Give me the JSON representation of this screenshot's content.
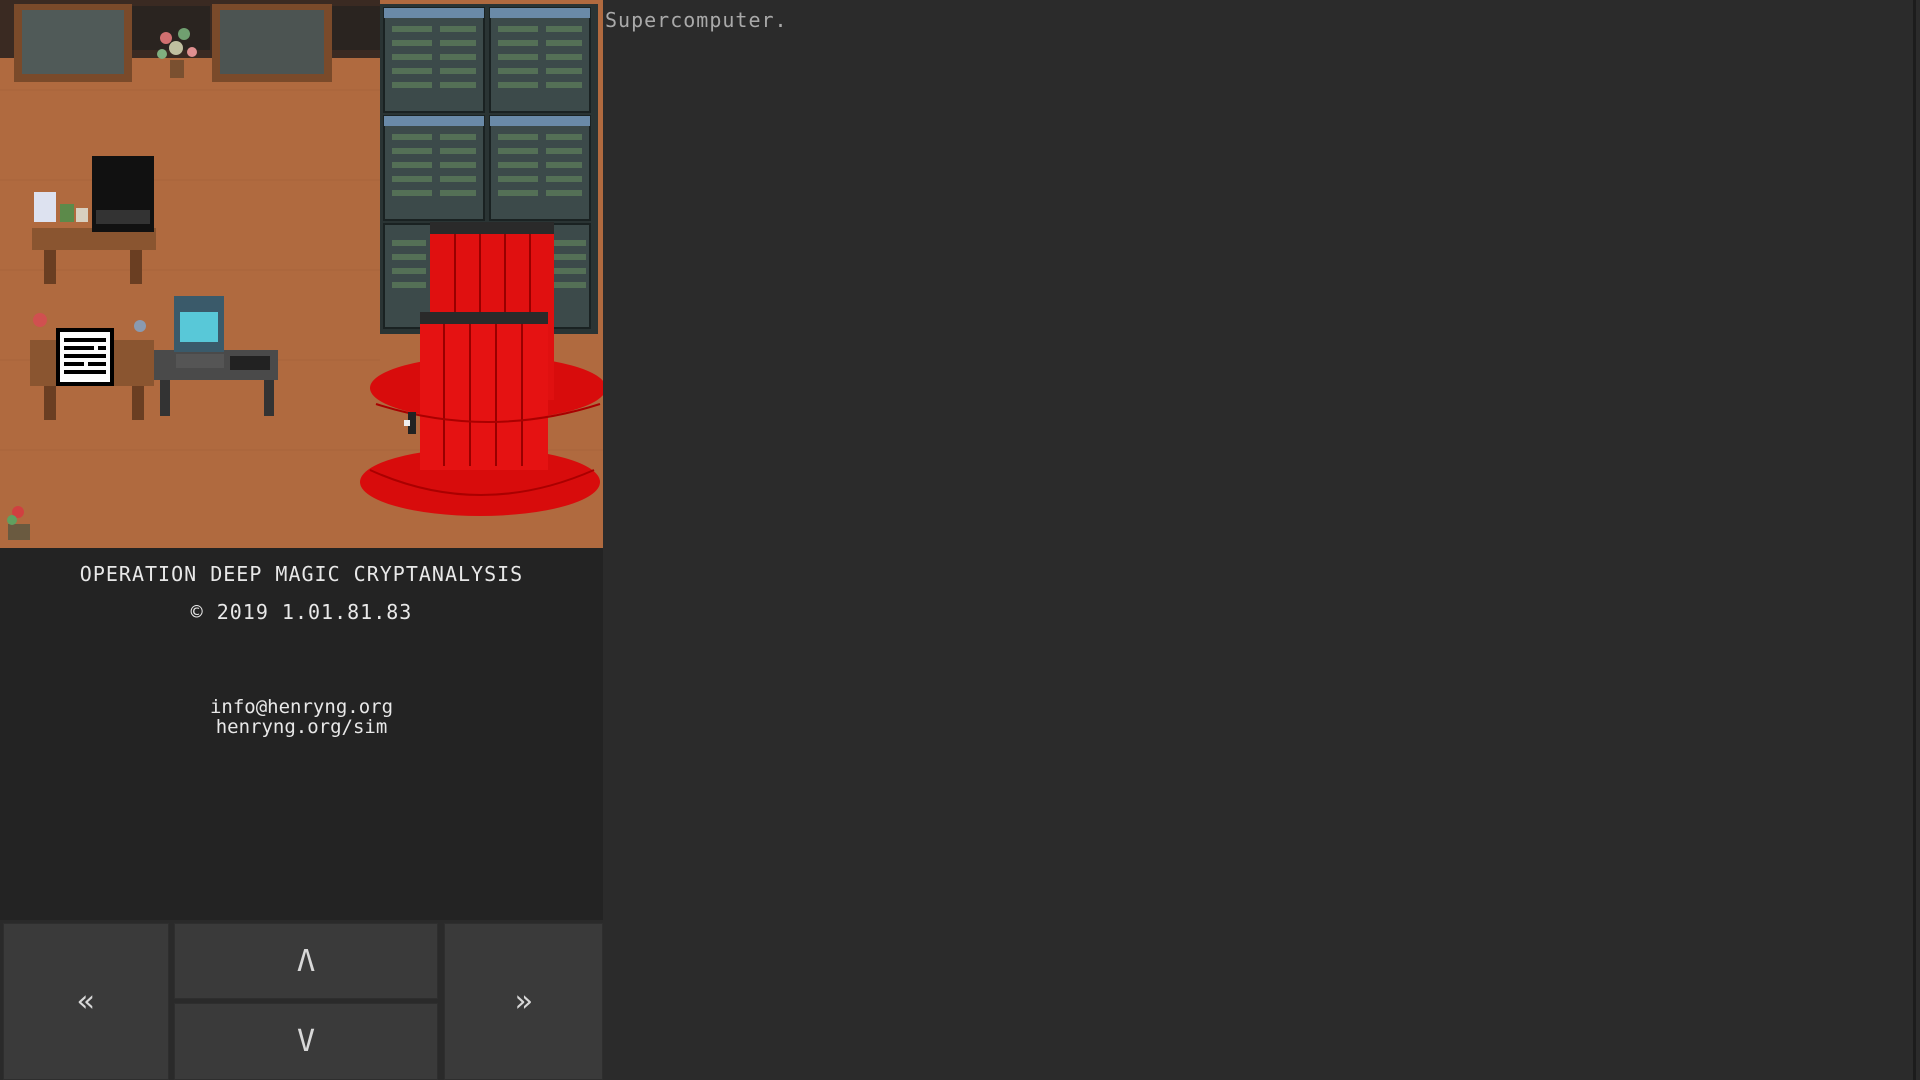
{
  "app": {
    "title": "OPERATION DEEP MAGIC CRYPTANALYSIS",
    "copyright": "© 2019 1.01.81.83",
    "email": "info@henryng.org",
    "site": "henryng.org/sim"
  },
  "controls": {
    "prev_label": "«",
    "up_label": "Λ",
    "down_label": "V",
    "next_label": "»"
  },
  "output": {
    "text": "Supercomputer."
  },
  "colors": {
    "floor": "#b06a3f",
    "panel": "#232323",
    "background": "#2b2b2b",
    "button": "#3a3a3a",
    "supercomputer_red": "#e01010",
    "server_rack": "#3c4a4a"
  },
  "icons": {
    "prev": "double-chevron-left-icon",
    "up": "chevron-up-icon",
    "down": "chevron-down-icon",
    "next": "double-chevron-right-icon"
  }
}
